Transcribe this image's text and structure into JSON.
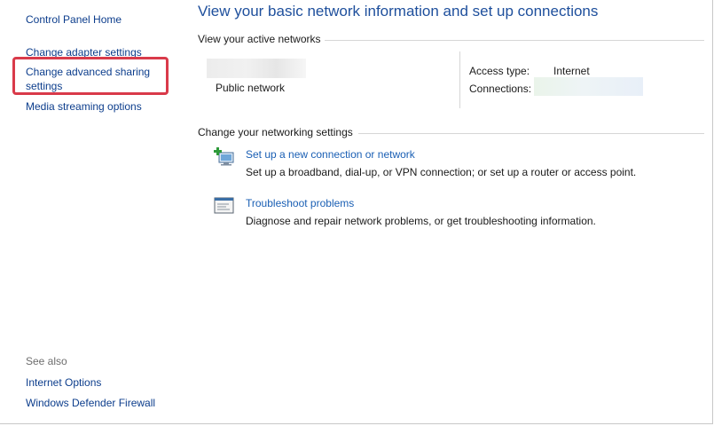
{
  "sidebar": {
    "home": "Control Panel Home",
    "items": [
      {
        "label": "Change adapter settings"
      },
      {
        "label": "Change advanced sharing"
      },
      {
        "label": "settings"
      },
      {
        "label": "Media streaming options"
      }
    ],
    "see_also": {
      "title": "See also",
      "items": [
        {
          "label": "Internet Options"
        },
        {
          "label": "Windows Defender Firewall"
        }
      ]
    },
    "highlight_color": "#d93a4a"
  },
  "main": {
    "title": "View your basic network information and set up connections",
    "active_networks": {
      "heading": "View your active networks",
      "network_type": "Public network",
      "access_type_label": "Access type:",
      "access_type_value": "Internet",
      "connections_label": "Connections:"
    },
    "settings": {
      "heading": "Change your networking settings",
      "tasks": [
        {
          "icon": "network-setup-icon",
          "link": "Set up a new connection or network",
          "desc": "Set up a broadband, dial-up, or VPN connection; or set up a router or access point."
        },
        {
          "icon": "troubleshoot-icon",
          "link": "Troubleshoot problems",
          "desc": "Diagnose and repair network problems, or get troubleshooting information."
        }
      ]
    }
  },
  "colors": {
    "title_blue": "#1e4f9c",
    "link_blue": "#1a5fb4",
    "sidebar_link": "#0c3d8c"
  }
}
